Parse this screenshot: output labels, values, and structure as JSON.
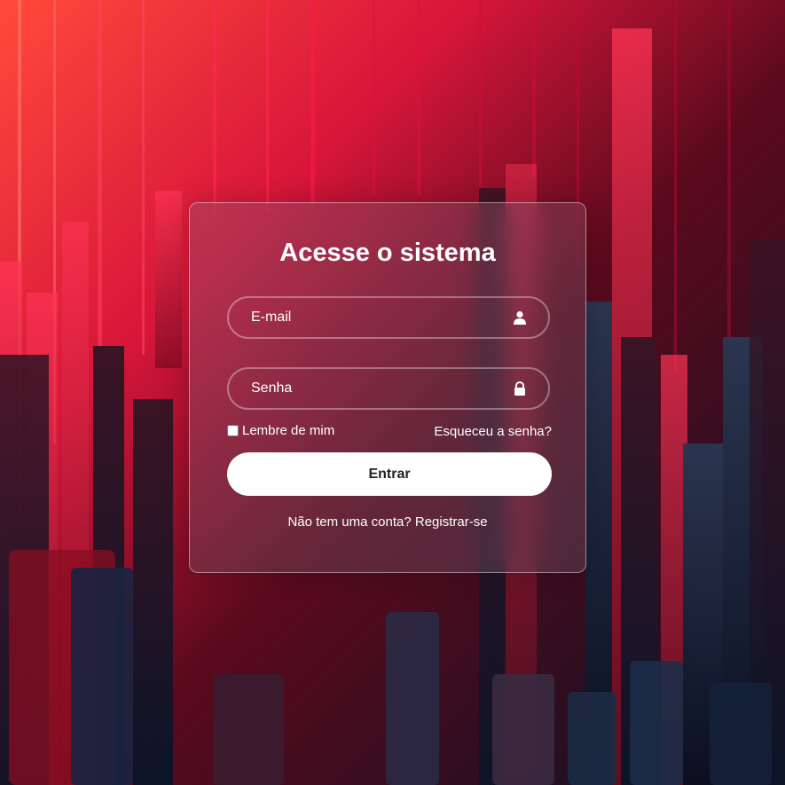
{
  "login": {
    "title": "Acesse o sistema",
    "email": {
      "placeholder": "E-mail",
      "value": "",
      "icon": "user-icon"
    },
    "password": {
      "placeholder": "Senha",
      "value": "",
      "icon": "lock-icon"
    },
    "remember_label": "Lembre de mim",
    "remember_checked": false,
    "forgot_link": "Esqueceu a senha?",
    "submit_label": "Entrar",
    "register_prompt": "Não tem uma conta?",
    "register_link": "Registrar-se"
  },
  "background": {
    "description_icon": "abstract-red-bars-image",
    "colors": {
      "top_left": "#ff3a3a",
      "red": "#c8102e",
      "dark_red": "#5a0a1c",
      "navy": "#0c1326"
    }
  }
}
